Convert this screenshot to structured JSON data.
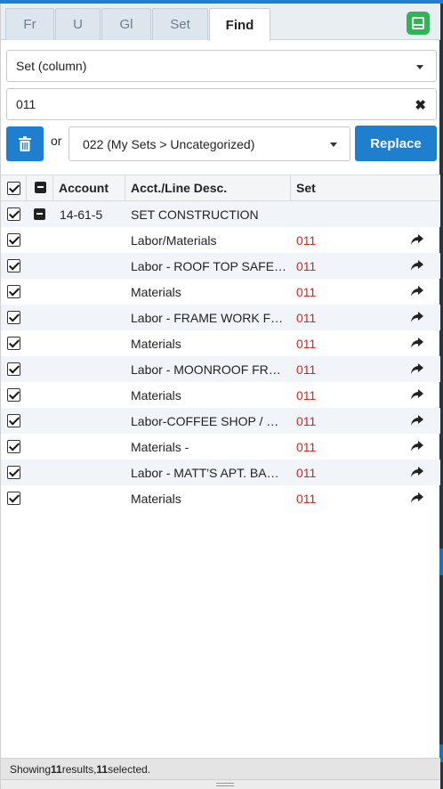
{
  "tabs": [
    {
      "label": "Fr",
      "active": false
    },
    {
      "label": "U",
      "active": false
    },
    {
      "label": "Gl",
      "active": false
    },
    {
      "label": "Set",
      "active": false
    },
    {
      "label": "Find",
      "active": true
    }
  ],
  "colors": {
    "accent": "#1d7fce",
    "layout_button": "#2fb456",
    "set_value": "#d0281f"
  },
  "find": {
    "column_select": "Set (column)",
    "search_value": "011",
    "or_label": "or",
    "replace_select": "022 (My Sets > Uncategorized)",
    "replace_button": "Replace"
  },
  "table": {
    "headers": {
      "account": "Account",
      "desc": "Acct./Line Desc.",
      "set": "Set"
    },
    "group": {
      "account": "14-61-5",
      "desc": "SET CONSTRUCTION"
    },
    "rows": [
      {
        "desc": "Labor/Materials",
        "set": "011"
      },
      {
        "desc": "Labor - ROOF TOP SAFE…",
        "set": "011"
      },
      {
        "desc": "Materials",
        "set": "011"
      },
      {
        "desc": "Labor - FRAME WORK F…",
        "set": "011"
      },
      {
        "desc": "Materials",
        "set": "011"
      },
      {
        "desc": "Labor - MOONROOF FR…",
        "set": "011"
      },
      {
        "desc": "Materials",
        "set": "011"
      },
      {
        "desc": "Labor-COFFEE SHOP / …",
        "set": "011"
      },
      {
        "desc": "Materials -",
        "set": "011"
      },
      {
        "desc": "Labor - MATT'S APT. BA…",
        "set": "011"
      },
      {
        "desc": "Materials",
        "set": "011"
      }
    ]
  },
  "footer": {
    "prefix": "Showing ",
    "results_count": "11",
    "middle": " results, ",
    "selected_count": "11",
    "suffix": " selected."
  }
}
